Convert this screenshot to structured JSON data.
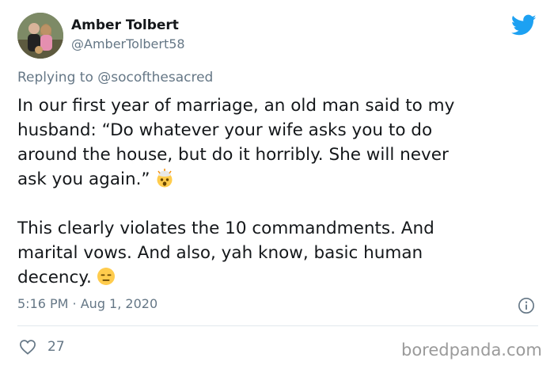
{
  "tweet": {
    "author": {
      "display_name": "Amber Tolbert",
      "handle": "@AmberTolbert58"
    },
    "reply": {
      "prefix": "Replying to",
      "mention": "@socofthesacred"
    },
    "body": {
      "paragraph1": [
        "In our first year of marriage, an old man said to my",
        "husband: “Do whatever your wife asks you to do",
        "around the house, but do it horribly. She will never",
        "ask you again.”"
      ],
      "paragraph2": [
        "This clearly violates the 10 commandments. And",
        "marital vows. And also, yah know, basic human",
        "decency."
      ]
    },
    "timestamp": "5:16 PM · Aug 1, 2020",
    "likes": "27"
  },
  "icons": {
    "brand": "twitter-bird-icon",
    "emoji1": "exploding-head-emoji",
    "emoji2": "expressionless-face-emoji",
    "info": "info-icon",
    "like": "heart-icon"
  },
  "colors": {
    "twitter_blue": "#1da1f2",
    "secondary_text": "#657786",
    "divider": "#e1e8ed"
  },
  "watermark": "boredpanda.com"
}
